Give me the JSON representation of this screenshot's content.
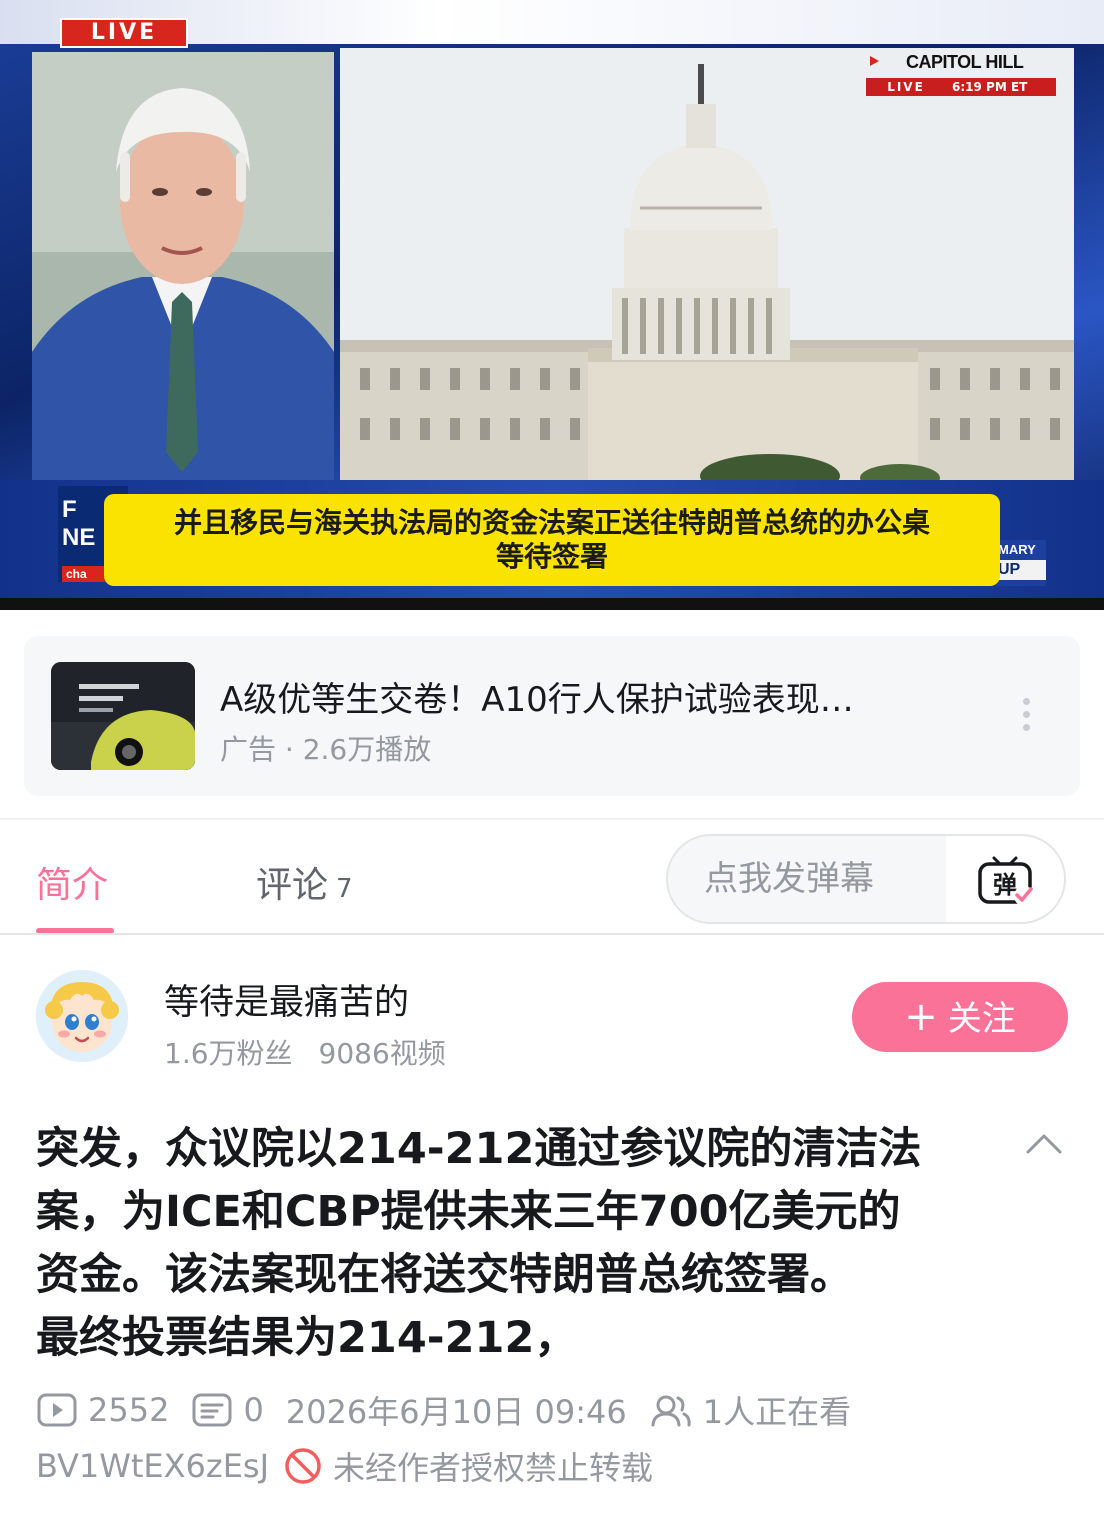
{
  "video": {
    "live_tag": "LIVE",
    "location_name": "CAPITOL HILL",
    "location_live": "LIVE",
    "location_time": "6:19 PM ET",
    "channel_logo_top": "F",
    "channel_logo_mid": "NE",
    "channel_logo_sub": "cha",
    "side_tag_top": "MARY",
    "side_tag_bottom": "UP",
    "subtitle_line1": "并且移民与海关执法局的资金法案正送往特朗普总统的办公桌",
    "subtitle_line2": "等待签署"
  },
  "ad": {
    "title": "A级优等生交卷！A10行人保护试验表现…",
    "meta": "广告 · 2.6万播放"
  },
  "tabs": {
    "intro": "简介",
    "comments": "评论",
    "comments_count": "7"
  },
  "danmaku": {
    "placeholder": "点我发弹幕",
    "icon_char": "弹"
  },
  "uploader": {
    "name": "等待是最痛苦的",
    "fans": "1.6万粉丝",
    "videos": "9086视频",
    "follow_label": "关注",
    "follow_plus": "+"
  },
  "description": {
    "line1": "突发，众议院以214-212通过参议院的清洁法",
    "line2": "案，为ICE和CBP提供未来三年700亿美元的",
    "line3": "资金。该法案现在将送交特朗普总统签署。",
    "line4": "最终投票结果为214-212，"
  },
  "stats": {
    "plays": "2552",
    "danmaku_count": "0",
    "date": "2026年6月10日 09:46",
    "watching": "1人正在看",
    "bvid": "BV1WtEX6zEsJ",
    "copyright": "未经作者授权禁止转载"
  },
  "colors": {
    "accent": "#fb7299",
    "secondary_text": "#9499a0",
    "subtitle_bg": "#fbe300",
    "prohibit": "#f25d5d"
  },
  "icons": {
    "more": "more-vertical-icon",
    "danmaku": "danmaku-toggle-icon",
    "collapse": "chevron-up-icon",
    "plays": "play-count-icon",
    "danmaku_count": "danmaku-count-icon",
    "watching": "watching-people-icon",
    "copyright": "prohibit-icon"
  }
}
